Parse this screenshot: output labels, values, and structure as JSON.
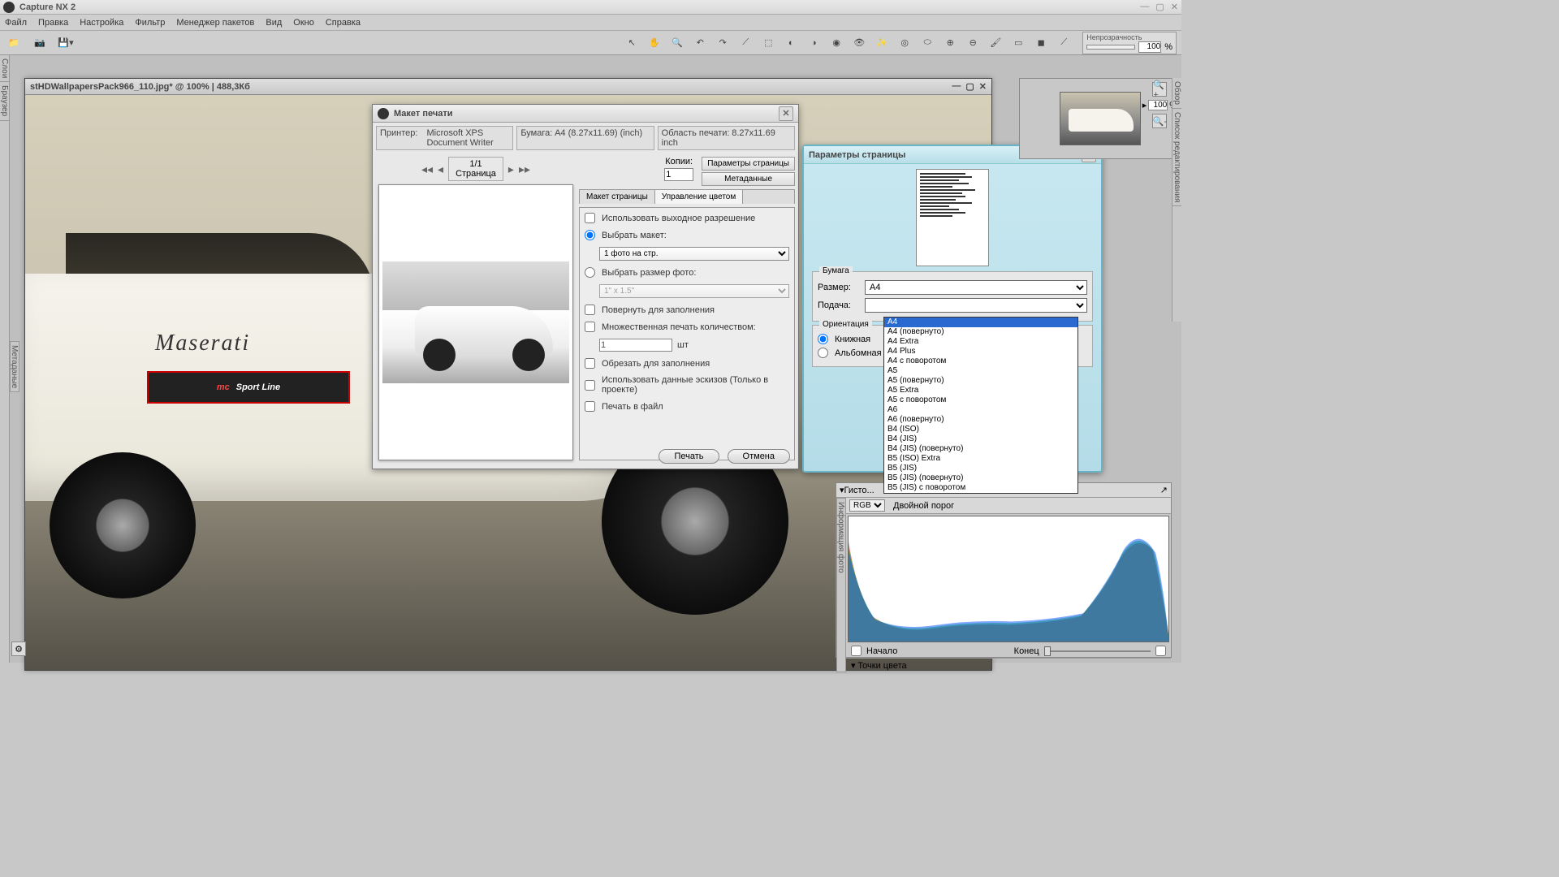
{
  "app": {
    "title": "Capture NX 2"
  },
  "menu": [
    "Файл",
    "Правка",
    "Настройка",
    "Фильтр",
    "Менеджер пакетов",
    "Вид",
    "Окно",
    "Справка"
  ],
  "opacity": {
    "label": "Непрозрачность",
    "value": "100",
    "pct": "%"
  },
  "doc": {
    "title": "stHDWallpapersPack966_110.jpg* @ 100% | 488,3Кб"
  },
  "sidetabs": {
    "layers": "Слои",
    "browser": "Браузер",
    "meta": "Метаданые",
    "overview": "Обзор",
    "editlist": "Список редактирования",
    "photoinfo": "Информация фото"
  },
  "badge": {
    "mc": "mc",
    "line": "Sport Line"
  },
  "brand": "Maserati",
  "print": {
    "title": "Макет печати",
    "printer_lbl": "Принтер:",
    "printer_val": "Microsoft XPS Document Writer",
    "paper_lbl": "Бумага:",
    "paper_val": "A4 (8.27x11.69) (inch)",
    "area_lbl": "Область печати:",
    "area_val": "8.27x11.69 inch",
    "page_cur": "1/1",
    "page_lbl": "Страница",
    "copies_lbl": "Копии:",
    "copies_val": "1",
    "btn_params": "Параметры страницы",
    "btn_meta": "Метаданные",
    "tab_layout": "Макет страницы",
    "tab_color": "Управление цветом",
    "opt_outres": "Использовать выходное разрешение",
    "opt_layout": "Выбрать макет:",
    "layout_val": "1 фото на стр.",
    "opt_size": "Выбрать размер фото:",
    "size_val": "1\" x 1.5\"",
    "opt_rotate": "Повернуть для заполнения",
    "opt_multi": "Множественная печать количеством:",
    "multi_val": "1",
    "multi_unit": "шт",
    "opt_crop": "Обрезать для заполнения",
    "opt_thumb": "Использовать данные эскизов (Только в проекте)",
    "opt_file": "Печать в файл",
    "btn_print": "Печать",
    "btn_cancel": "Отмена"
  },
  "pagedlg": {
    "title": "Параметры страницы",
    "grp_paper": "Бумага",
    "size_lbl": "Размер:",
    "size_val": "A4",
    "feed_lbl": "Подача:",
    "grp_orient": "Ориентация",
    "orient_portrait": "Книжная",
    "orient_landscape": "Альбомная"
  },
  "sizes": [
    "A4",
    "A4 (повернуто)",
    "A4 Extra",
    "A4 Plus",
    "A4 с поворотом",
    "A5",
    "A5 (повернуто)",
    "A5 Extra",
    "A5 с поворотом",
    "A6",
    "A6 (повернуто)",
    "B4 (ISO)",
    "B4 (JIS)",
    "B4 (JIS) (повернуто)",
    "B5 (ISO) Extra",
    "B5 (JIS)",
    "B5 (JIS) (повернуто)",
    "B5 (JIS) с поворотом"
  ],
  "histo": {
    "title": "Гисто...",
    "channel": "RGB",
    "dual": "Двойной порог",
    "start": "Начало",
    "end": "Конец",
    "colorpts": "Точки цвета"
  },
  "zoom": {
    "val": "100",
    "pct": "%"
  }
}
